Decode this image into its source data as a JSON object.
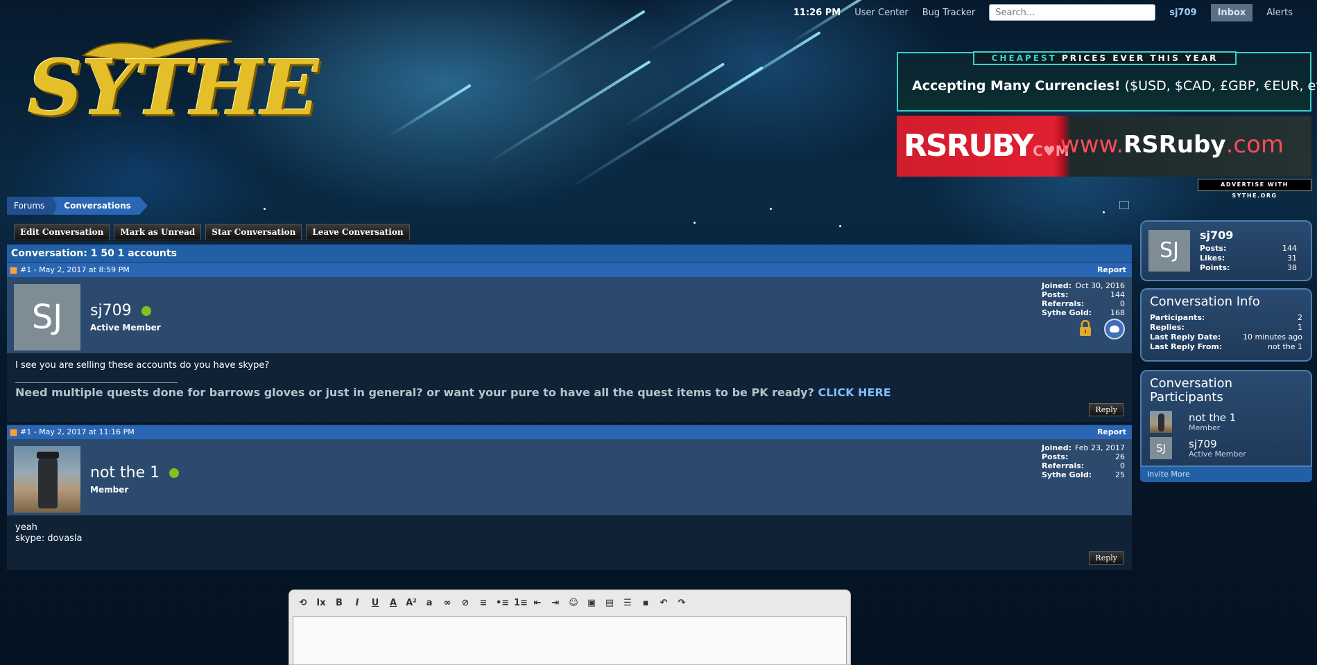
{
  "topbar": {
    "time": "11:26 PM",
    "user_center": "User Center",
    "bug_tracker": "Bug Tracker",
    "search_placeholder": "Search...",
    "username": "sj709",
    "inbox": "Inbox",
    "alerts": "Alerts"
  },
  "logo": {
    "text": "SYTHE"
  },
  "ads": {
    "banner1_tab_highlight": "CHEAPEST",
    "banner1_tab_rest": " PRICES EVER THIS YEAR",
    "banner1_bold": "Accepting Many Currencies!",
    "banner1_rest": " ($USD, $CAD, £GBP, €EUR, etc!)",
    "banner2_brand": "RSRUBY",
    "banner2_brand_suffix": "C♥M",
    "banner2_url_pre": "www.",
    "banner2_url_bold": "RSRuby",
    "banner2_url_post": ".com",
    "advertise": "ADVERTISE WITH SYTHE.ORG"
  },
  "breadcrumb": [
    "Forums",
    "Conversations"
  ],
  "actions": [
    "Edit Conversation",
    "Mark as Unread",
    "Star Conversation",
    "Leave Conversation"
  ],
  "conversation": {
    "title": "Conversation: 1 50 1 accounts",
    "posts": [
      {
        "meta": "#1 - May 2, 2017 at 8:59 PM",
        "report": "Report",
        "avatar_initials": "SJ",
        "username": "sj709",
        "rank": "Active Member",
        "stats": [
          {
            "k": "Joined:",
            "v": "Oct 30, 2016"
          },
          {
            "k": "Posts:",
            "v": "144"
          },
          {
            "k": "Referrals:",
            "v": "0"
          },
          {
            "k": "Sythe Gold:",
            "v": "168"
          }
        ],
        "message": "I see you are selling these accounts do you have skype?",
        "signature": "Need multiple quests done for barrows gloves or just in general? or want your pure to have all the quest items to be PK ready?",
        "signature_link": "CLICK HERE",
        "reply": "Reply"
      },
      {
        "meta": "#1 - May 2, 2017 at 11:16 PM",
        "report": "Report",
        "username": "not the 1",
        "rank": "Member",
        "stats": [
          {
            "k": "Joined:",
            "v": "Feb 23, 2017"
          },
          {
            "k": "Posts:",
            "v": "26"
          },
          {
            "k": "Referrals:",
            "v": "0"
          },
          {
            "k": "Sythe Gold:",
            "v": "25"
          }
        ],
        "message_line1": "yeah",
        "message_line2": "skype: dovasla",
        "reply": "Reply"
      }
    ]
  },
  "sidebar": {
    "me": {
      "initials": "SJ",
      "name": "sj709",
      "stats": [
        {
          "k": "Posts:",
          "v": "144"
        },
        {
          "k": "Likes:",
          "v": "31"
        },
        {
          "k": "Points:",
          "v": "38"
        }
      ]
    },
    "info": {
      "title": "Conversation Info",
      "rows": [
        {
          "k": "Participants:",
          "v": "2"
        },
        {
          "k": "Replies:",
          "v": "1"
        },
        {
          "k": "Last Reply Date:",
          "v": "10 minutes ago"
        },
        {
          "k": "Last Reply From:",
          "v": "not the 1"
        }
      ]
    },
    "participants": {
      "title_line1": "Conversation",
      "title_line2": "Participants",
      "list": [
        {
          "name": "not the 1",
          "rank": "Member"
        },
        {
          "initials": "SJ",
          "name": "sj709",
          "rank": "Active Member"
        }
      ],
      "invite": "Invite More"
    }
  },
  "editor": {
    "tools": [
      "remove-format",
      "clear-format",
      "bold",
      "italic",
      "underline",
      "font-color",
      "font-size",
      "font-family",
      "link",
      "unlink",
      "align",
      "bullet-list",
      "numbered-list",
      "outdent",
      "indent",
      "smilies",
      "image",
      "media",
      "quote",
      "save",
      "undo",
      "redo"
    ]
  }
}
